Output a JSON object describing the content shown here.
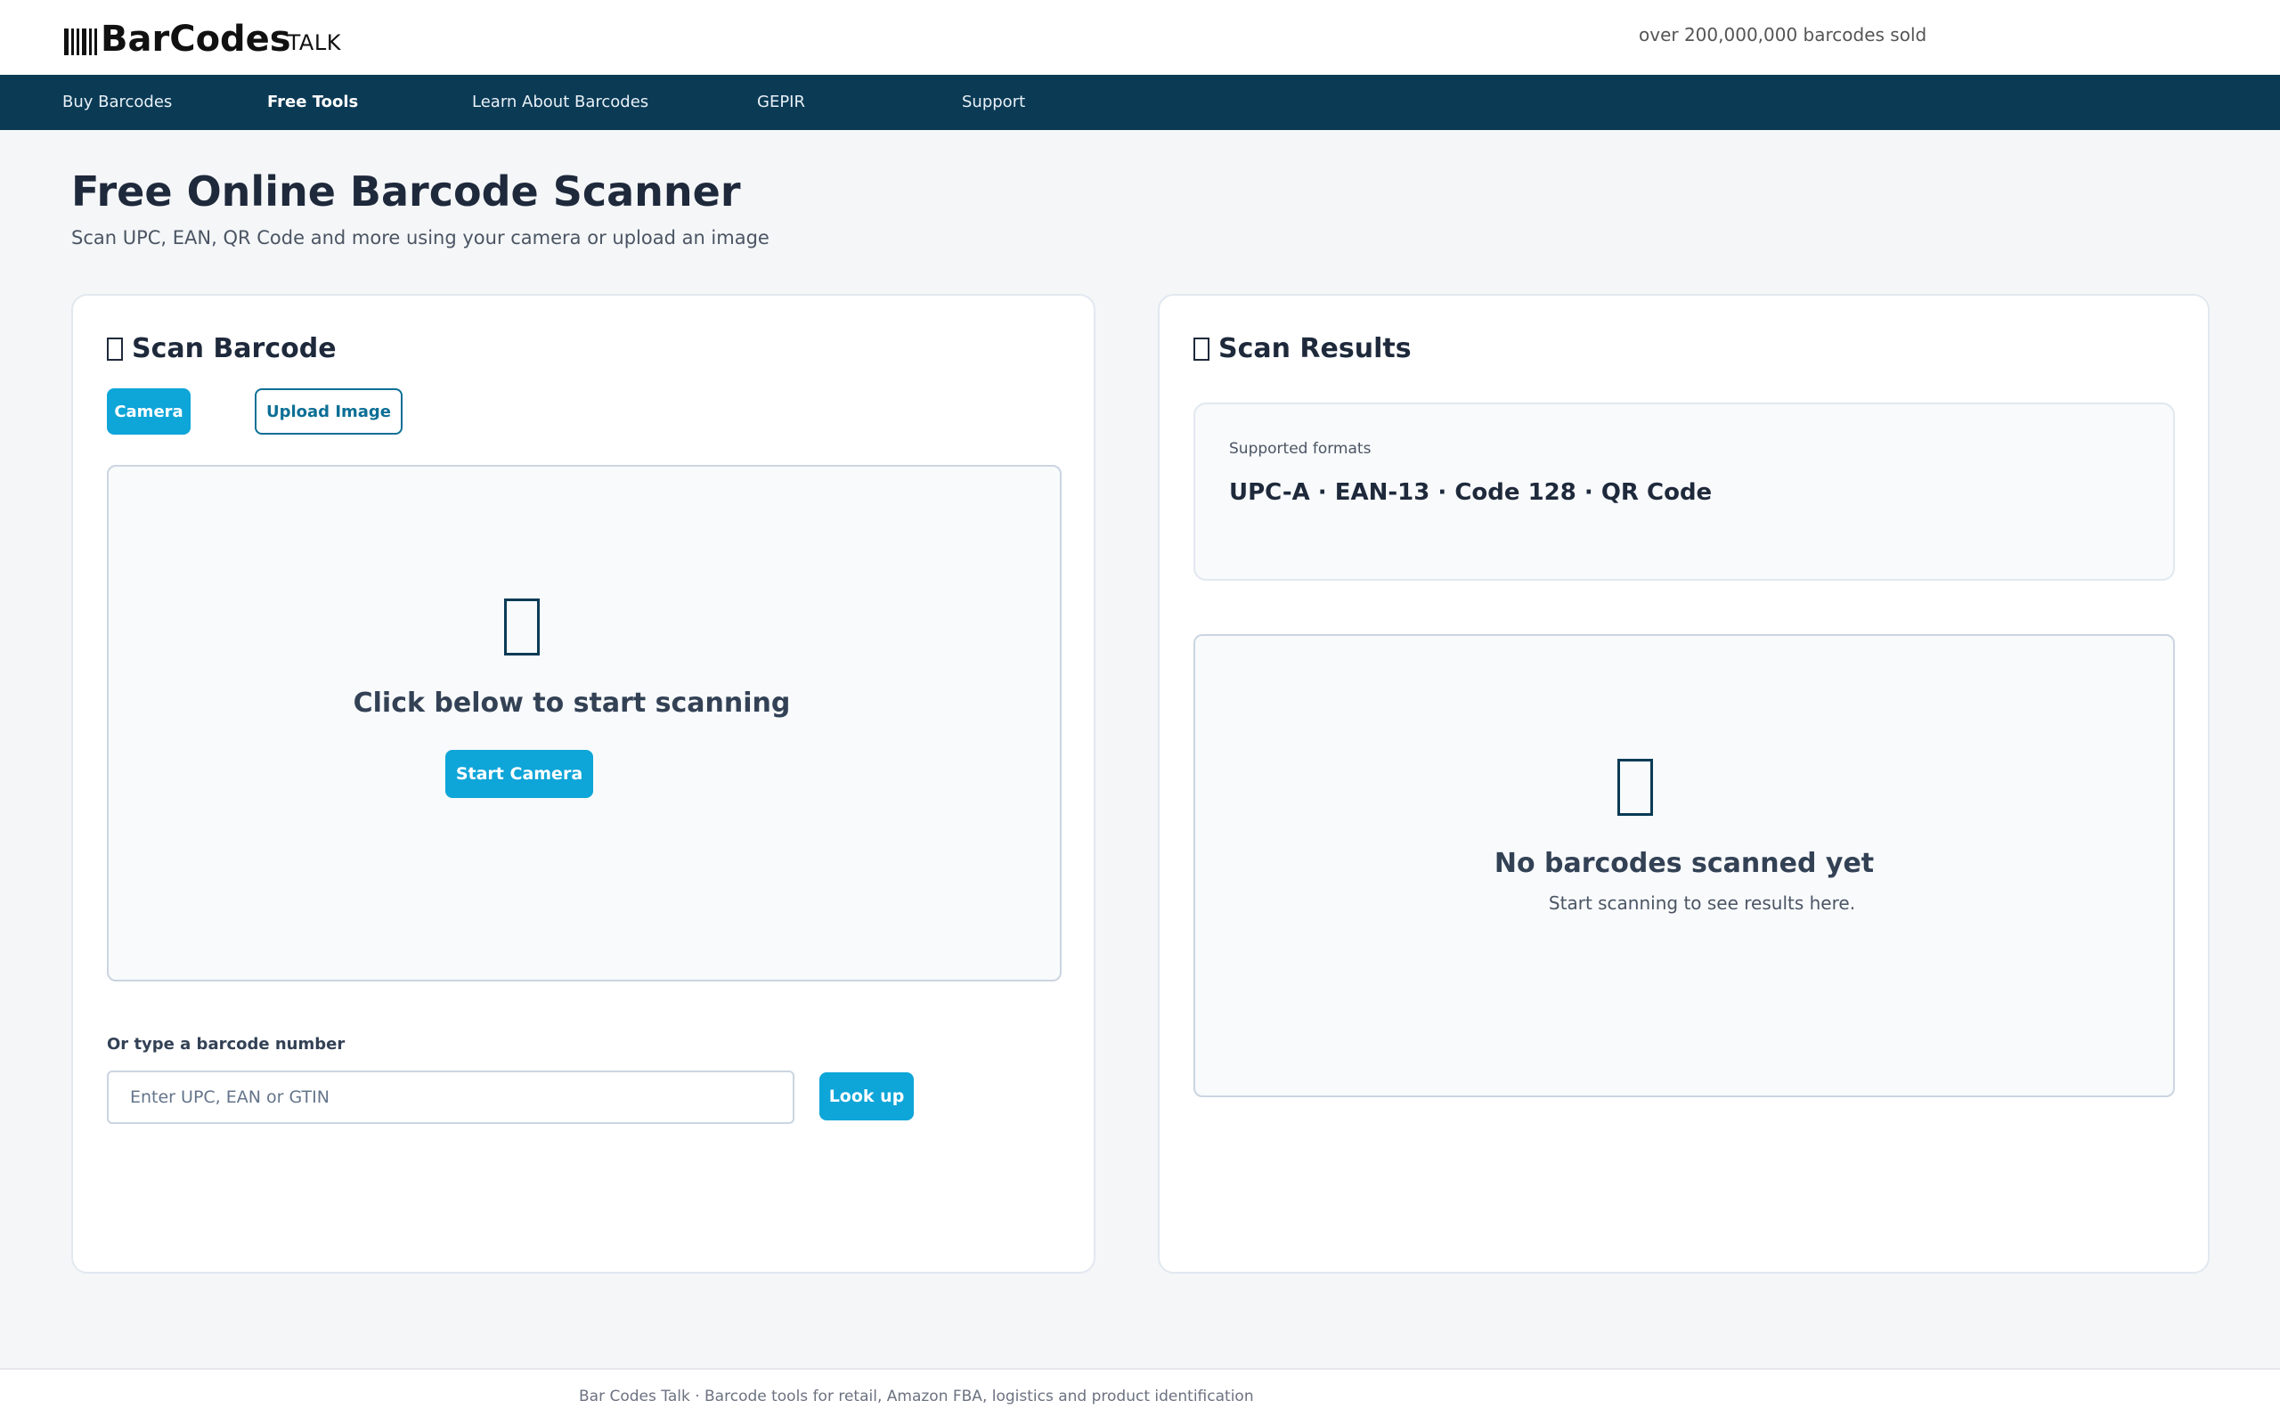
{
  "header": {
    "logo_main": "BarCodes",
    "logo_sub": "TALK",
    "logo_icon": "barcode-icon",
    "tagline": "over 200,000,000 barcodes sold"
  },
  "nav": {
    "items": [
      {
        "label": "Buy Barcodes",
        "active": false
      },
      {
        "label": "Free Tools",
        "active": true
      },
      {
        "label": "Learn About Barcodes",
        "active": false
      },
      {
        "label": "GEPIR",
        "active": false
      },
      {
        "label": "Support",
        "active": false
      }
    ]
  },
  "page": {
    "title": "Free Online Barcode Scanner",
    "subtitle": "Scan UPC, EAN, QR Code and more using your camera or upload an image"
  },
  "scanner": {
    "title": "Scan Barcode",
    "title_icon": "camera-icon",
    "tabs": [
      {
        "label": "Camera",
        "active": true
      },
      {
        "label": "Upload Image",
        "active": false
      }
    ],
    "area_icon": "camera-icon",
    "prompt": "Click below to start scanning",
    "start_button": "Start Camera",
    "manual_label": "Or type a barcode number",
    "input_placeholder": "Enter UPC, EAN or GTIN",
    "input_value": "",
    "lookup_button": "Look up"
  },
  "results": {
    "title": "Scan Results",
    "title_icon": "results-icon",
    "formats_label": "Supported formats",
    "formats": "UPC-A · EAN-13 · Code 128 · QR Code",
    "empty_icon": "barcode-icon",
    "empty_title": "No barcodes scanned yet",
    "empty_subtitle": "Start scanning to see results here."
  },
  "footer": {
    "text": "Bar Codes Talk · Barcode tools for retail, Amazon FBA, logistics and product identification"
  },
  "colors": {
    "nav_background": "#0b3a55",
    "accent": "#0ea5d8",
    "page_background": "#f4f6f8"
  }
}
